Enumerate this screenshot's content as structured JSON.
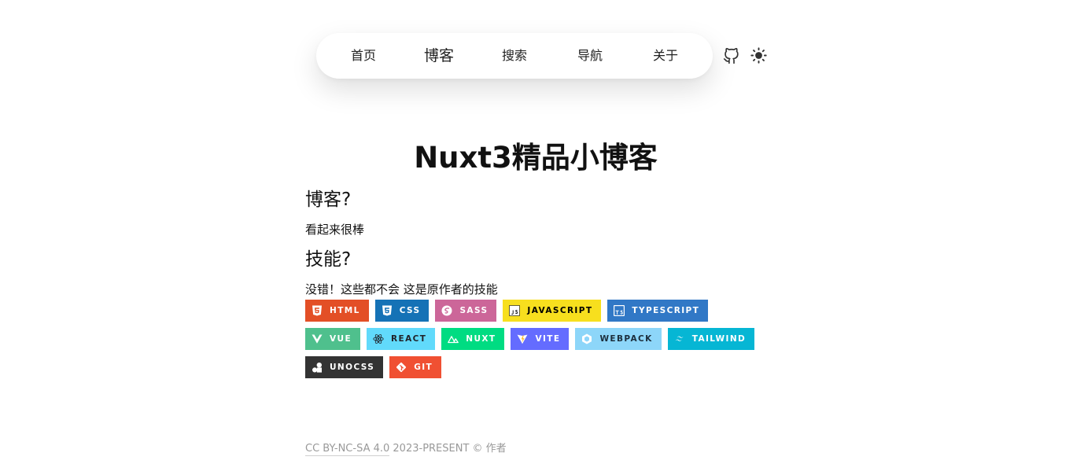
{
  "nav": {
    "links": [
      {
        "label": "首页"
      },
      {
        "label": "博客"
      },
      {
        "label": "搜索"
      },
      {
        "label": "导航"
      },
      {
        "label": "关于"
      }
    ],
    "github_icon": "github-icon",
    "theme_icon": "sun-icon"
  },
  "main": {
    "title": "Nuxt3精品小博客",
    "blog_heading": "博客?",
    "blog_text": "看起来很棒",
    "skills_heading": "技能?",
    "skills_text": "没错！这些都不会 这是原作者的技能",
    "badges": [
      {
        "label": "HTML",
        "icon": "html5-icon",
        "bg": "#E34F26",
        "fg": "#FFFFFF"
      },
      {
        "label": "CSS",
        "icon": "css3-icon",
        "bg": "#1572B6",
        "fg": "#FFFFFF"
      },
      {
        "label": "SASS",
        "icon": "sass-icon",
        "bg": "#CC6699",
        "fg": "#FFFFFF"
      },
      {
        "label": "JAVASCRIPT",
        "icon": "javascript-icon",
        "bg": "#F7DF1E",
        "fg": "#000000"
      },
      {
        "label": "TYPESCRIPT",
        "icon": "typescript-icon",
        "bg": "#3178C6",
        "fg": "#FFFFFF"
      },
      {
        "label": "VUE",
        "icon": "vue-icon",
        "bg": "#4FC08D",
        "fg": "#FFFFFF"
      },
      {
        "label": "REACT",
        "icon": "react-icon",
        "bg": "#61DAFB",
        "fg": "#20232A"
      },
      {
        "label": "NUXT",
        "icon": "nuxt-icon",
        "bg": "#00DC82",
        "fg": "#FFFFFF"
      },
      {
        "label": "VITE",
        "icon": "vite-icon",
        "bg": "#646CFF",
        "fg": "#FFFFFF"
      },
      {
        "label": "WEBPACK",
        "icon": "webpack-icon",
        "bg": "#8DD6F9",
        "fg": "#1C2E3C"
      },
      {
        "label": "TAILWIND",
        "icon": "tailwind-icon",
        "bg": "#06B6D4",
        "fg": "#FFFFFF"
      },
      {
        "label": "UNOCSS",
        "icon": "unocss-icon",
        "bg": "#333333",
        "fg": "#FFFFFF"
      },
      {
        "label": "GIT",
        "icon": "git-icon",
        "bg": "#F05032",
        "fg": "#FFFFFF"
      }
    ]
  },
  "footer": {
    "license": "CC BY-NC-SA 4.0",
    "copyright": " 2023-PRESENT © 作者"
  }
}
